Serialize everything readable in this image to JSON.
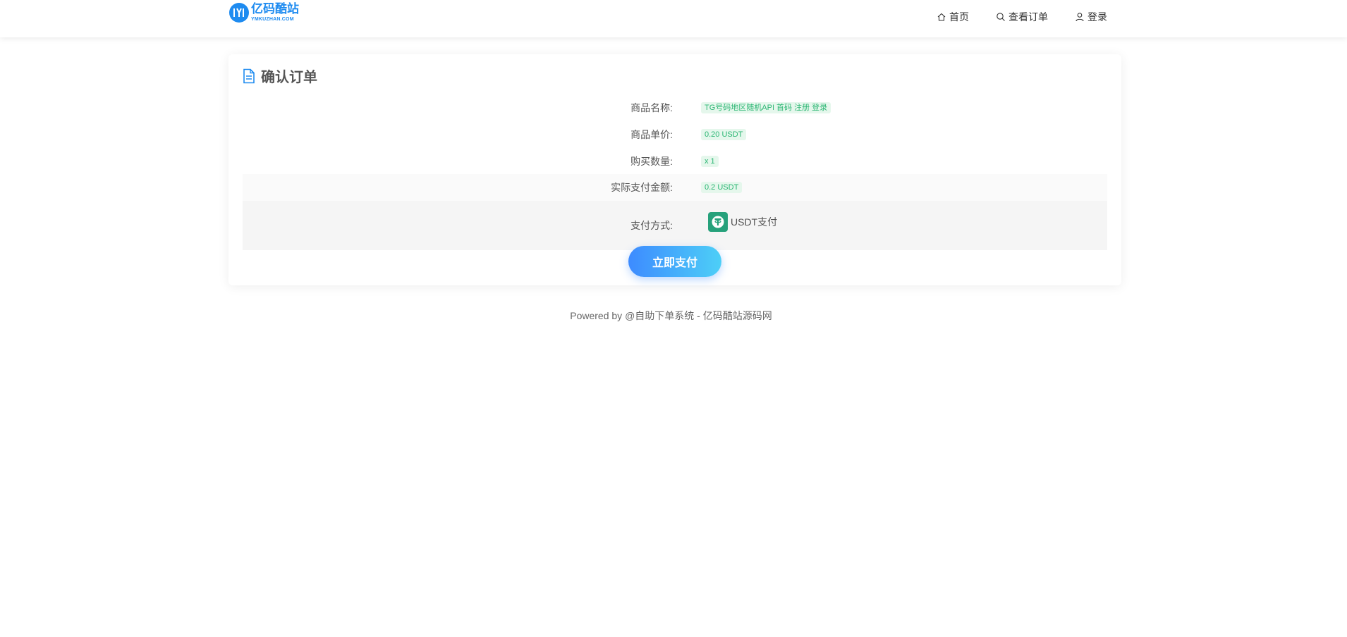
{
  "header": {
    "logo_cn": "亿码酷站",
    "logo_en": "YMKUZHAN.COM",
    "nav": [
      {
        "label": "首页",
        "icon": "home-icon"
      },
      {
        "label": "查看订单",
        "icon": "search-icon"
      },
      {
        "label": "登录",
        "icon": "user-icon"
      }
    ]
  },
  "order": {
    "title": "确认订单",
    "rows": [
      {
        "label": "商品名称:",
        "value": "TG号码地区随机API 首码 注册 登录"
      },
      {
        "label": "商品单价:",
        "value": "0.20 USDT"
      },
      {
        "label": "购买数量:",
        "value": "x 1"
      },
      {
        "label": "实际支付金额:",
        "value": "0.2 USDT"
      }
    ],
    "payment": {
      "label": "支付方式:",
      "method": "USDT支付",
      "icon": "usdt-icon"
    },
    "pay_button": "立即支付"
  },
  "footer": {
    "text": "Powered by @自助下单系统 - 亿码酷站源码网"
  },
  "colors": {
    "accent": "#1e8bf0",
    "tag_bg": "#e5f7ec",
    "tag_text": "#2bb673",
    "usdt_green": "#26a17b",
    "button_start": "#3d8bff",
    "button_end": "#4dcff7"
  }
}
